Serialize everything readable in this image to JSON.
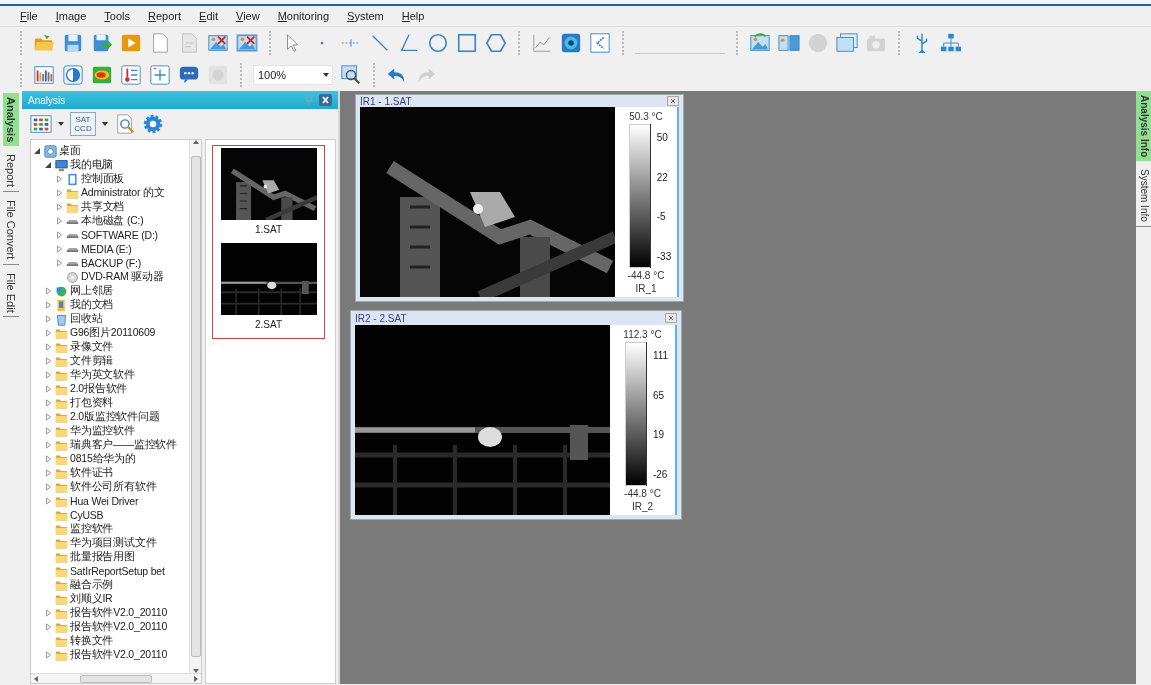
{
  "menu": [
    {
      "label": "File"
    },
    {
      "label": "Image"
    },
    {
      "label": "Tools"
    },
    {
      "label": "Report"
    },
    {
      "label": "Edit"
    },
    {
      "label": "View"
    },
    {
      "label": "Monitoring"
    },
    {
      "label": "System"
    },
    {
      "label": "Help"
    }
  ],
  "zoom": {
    "value": "100%"
  },
  "left_tabs": [
    {
      "label": "Analysis",
      "selected": true
    },
    {
      "label": "Report",
      "selected": false
    },
    {
      "label": "File Convert",
      "selected": false
    },
    {
      "label": "File Edit",
      "selected": false
    }
  ],
  "analysis_panel": {
    "title": "Analysis",
    "source_icon_lines": [
      "SAT",
      "CCD"
    ],
    "tree": [
      {
        "label": "桌面",
        "kind": "desktop",
        "expandable": true,
        "expanded": true,
        "children": [
          {
            "label": "我的电脑",
            "kind": "computer",
            "expandable": true,
            "expanded": true,
            "children": [
              {
                "label": "控制面板",
                "kind": "control-panel",
                "expandable": true,
                "expanded": false
              },
              {
                "label": "Administrator 的文",
                "kind": "folder",
                "expandable": true,
                "expanded": false
              },
              {
                "label": "共享文档",
                "kind": "folder",
                "expandable": true,
                "expanded": false
              },
              {
                "label": "本地磁盘 (C:)",
                "kind": "drive",
                "expandable": true,
                "expanded": false
              },
              {
                "label": "SOFTWARE (D:)",
                "kind": "drive",
                "expandable": true,
                "expanded": false
              },
              {
                "label": "MEDIA (E:)",
                "kind": "drive",
                "expandable": true,
                "expanded": false
              },
              {
                "label": "BACKUP (F:)",
                "kind": "drive",
                "expandable": true,
                "expanded": false
              },
              {
                "label": "DVD-RAM 驱动器",
                "kind": "dvd",
                "expandable": false,
                "expanded": false
              }
            ]
          },
          {
            "label": "网上邻居",
            "kind": "network",
            "expandable": true,
            "expanded": false
          },
          {
            "label": "我的文档",
            "kind": "documents",
            "expandable": true,
            "expanded": false
          },
          {
            "label": "回收站",
            "kind": "recycle-bin",
            "expandable": true,
            "expanded": false
          },
          {
            "label": "G96图片20110609",
            "kind": "folder",
            "expandable": true,
            "expanded": false
          },
          {
            "label": "录像文件",
            "kind": "folder",
            "expandable": true,
            "expanded": false
          },
          {
            "label": "文件剪辑",
            "kind": "folder",
            "expandable": true,
            "expanded": false
          },
          {
            "label": "华为英文软件",
            "kind": "folder",
            "expandable": true,
            "expanded": false
          },
          {
            "label": "2.0报告软件",
            "kind": "folder",
            "expandable": true,
            "expanded": false
          },
          {
            "label": "打包资料",
            "kind": "folder",
            "expandable": true,
            "expanded": false
          },
          {
            "label": "2.0版监控软件问题",
            "kind": "folder",
            "expandable": true,
            "expanded": false
          },
          {
            "label": "华为监控软件",
            "kind": "folder",
            "expandable": true,
            "expanded": false
          },
          {
            "label": "瑞典客户——监控软件",
            "kind": "folder",
            "expandable": true,
            "expanded": false
          },
          {
            "label": "0815给华为的",
            "kind": "folder",
            "expandable": true,
            "expanded": false
          },
          {
            "label": "软件证书",
            "kind": "folder",
            "expandable": true,
            "expanded": false
          },
          {
            "label": "软件公司所有软件",
            "kind": "folder",
            "expandable": true,
            "expanded": false
          },
          {
            "label": "Hua Wei Driver",
            "kind": "folder",
            "expandable": true,
            "expanded": false
          },
          {
            "label": "CyUSB",
            "kind": "folder",
            "expandable": false,
            "expanded": false
          },
          {
            "label": "监控软件",
            "kind": "folder",
            "expandable": false,
            "expanded": false
          },
          {
            "label": "华为项目测试文件",
            "kind": "folder",
            "expandable": false,
            "expanded": false
          },
          {
            "label": "批量报告用图",
            "kind": "folder",
            "expandable": false,
            "expanded": false
          },
          {
            "label": "SatIrReportSetup bet",
            "kind": "folder",
            "expandable": false,
            "expanded": false
          },
          {
            "label": "融合示例",
            "kind": "folder",
            "expandable": false,
            "expanded": false
          },
          {
            "label": "刘顺义IR",
            "kind": "folder",
            "expandable": false,
            "expanded": false
          },
          {
            "label": "报告软件V2.0_20110",
            "kind": "folder",
            "expandable": true,
            "expanded": false
          },
          {
            "label": "报告软件V2.0_20110",
            "kind": "folder",
            "expandable": true,
            "expanded": false
          },
          {
            "label": "转换文件",
            "kind": "folder",
            "expandable": false,
            "expanded": false
          },
          {
            "label": "报告软件V2.0_20110",
            "kind": "folder",
            "expandable": true,
            "expanded": false
          }
        ]
      }
    ],
    "thumbnails": [
      {
        "label": "1.SAT"
      },
      {
        "label": "2.SAT"
      }
    ]
  },
  "image_windows": [
    {
      "title": "IR1 - 1.SAT",
      "max": "50.3 °C",
      "ticks": [
        "50",
        "22",
        "-5",
        "-33"
      ],
      "min": "-44.8 °C",
      "label": "IR_1"
    },
    {
      "title": "IR2 - 2.SAT",
      "max": "112.3 °C",
      "ticks": [
        "111",
        "65",
        "19",
        "-26"
      ],
      "min": "-44.8 °C",
      "label": "IR_2"
    }
  ],
  "right_tabs": [
    {
      "label": "Analysis Info",
      "selected": true
    },
    {
      "label": "System Info",
      "selected": false
    }
  ]
}
